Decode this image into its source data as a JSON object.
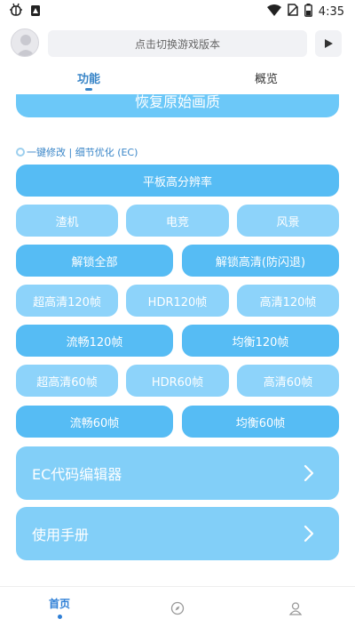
{
  "status_bar": {
    "time": "4:35"
  },
  "top_bar": {
    "version_placeholder": "点击切换游戏版本"
  },
  "tabs": [
    {
      "label": "功能",
      "active": true
    },
    {
      "label": "概览",
      "active": false
    }
  ],
  "restore_button": "恢复原始画质",
  "section": {
    "title": "一键修改 | 细节优化 (EC)"
  },
  "buttons": {
    "tablet_resolution": "平板高分辨率",
    "potato": "渣机",
    "esports": "电竞",
    "scenery": "风景",
    "unlock_all": "解锁全部",
    "unlock_hd": "解锁高清(防闪退)",
    "uhd_120": "超高清120帧",
    "hdr_120": "HDR120帧",
    "hd_120": "高清120帧",
    "smooth_120": "流畅120帧",
    "balanced_120": "均衡120帧",
    "uhd_60": "超高清60帧",
    "hdr_60": "HDR60帧",
    "hd_60": "高清60帧",
    "smooth_60": "流畅60帧",
    "balanced_60": "均衡60帧"
  },
  "cards": {
    "ec_editor": "EC代码编辑器",
    "manual": "使用手册"
  },
  "bottom_nav": {
    "home": "首页"
  }
}
